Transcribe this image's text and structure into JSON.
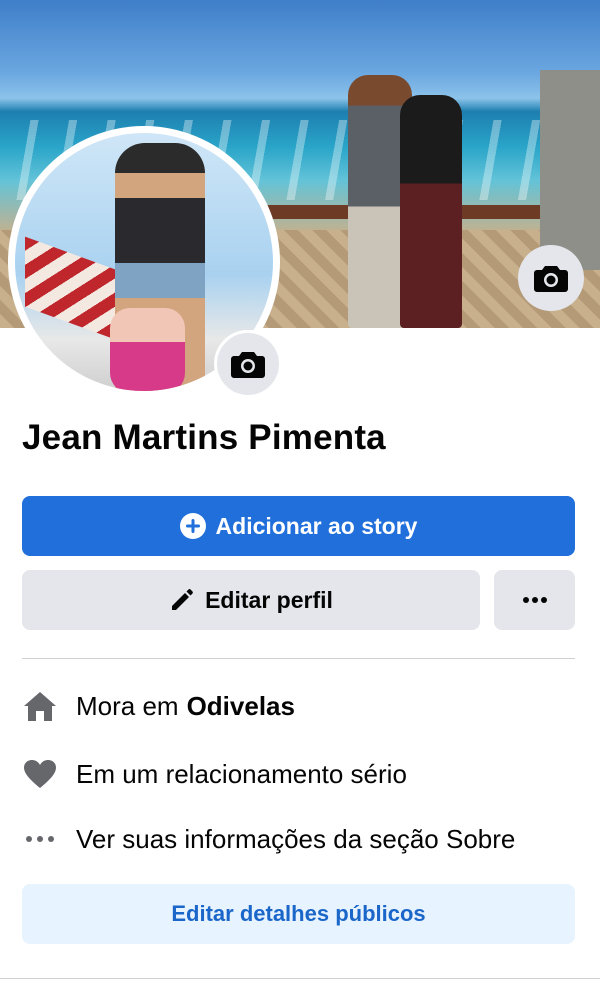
{
  "profile": {
    "name": "Jean Martins Pimenta"
  },
  "actions": {
    "add_story_label": "Adicionar ao story",
    "edit_profile_label": "Editar perfil",
    "edit_public_details_label": "Editar detalhes públicos"
  },
  "intro": {
    "lives_prefix": "Mora em",
    "lives_city": "Odivelas",
    "relationship": "Em um relacionamento sério",
    "see_about": "Ver suas informações da seção Sobre"
  },
  "icons": {
    "cover_camera": "camera-icon",
    "avatar_camera": "camera-icon",
    "add_story": "plus-circle-icon",
    "edit_profile": "pencil-icon",
    "more": "more-dots-icon",
    "lives": "home-icon",
    "relationship": "heart-icon",
    "see_about": "more-dots-icon"
  },
  "colors": {
    "primary_blue": "#216fdb",
    "secondary_gray": "#e4e6eb",
    "light_blue_bg": "#e7f3ff",
    "link_blue": "#1b66c9",
    "icon_gray": "#65676b"
  }
}
